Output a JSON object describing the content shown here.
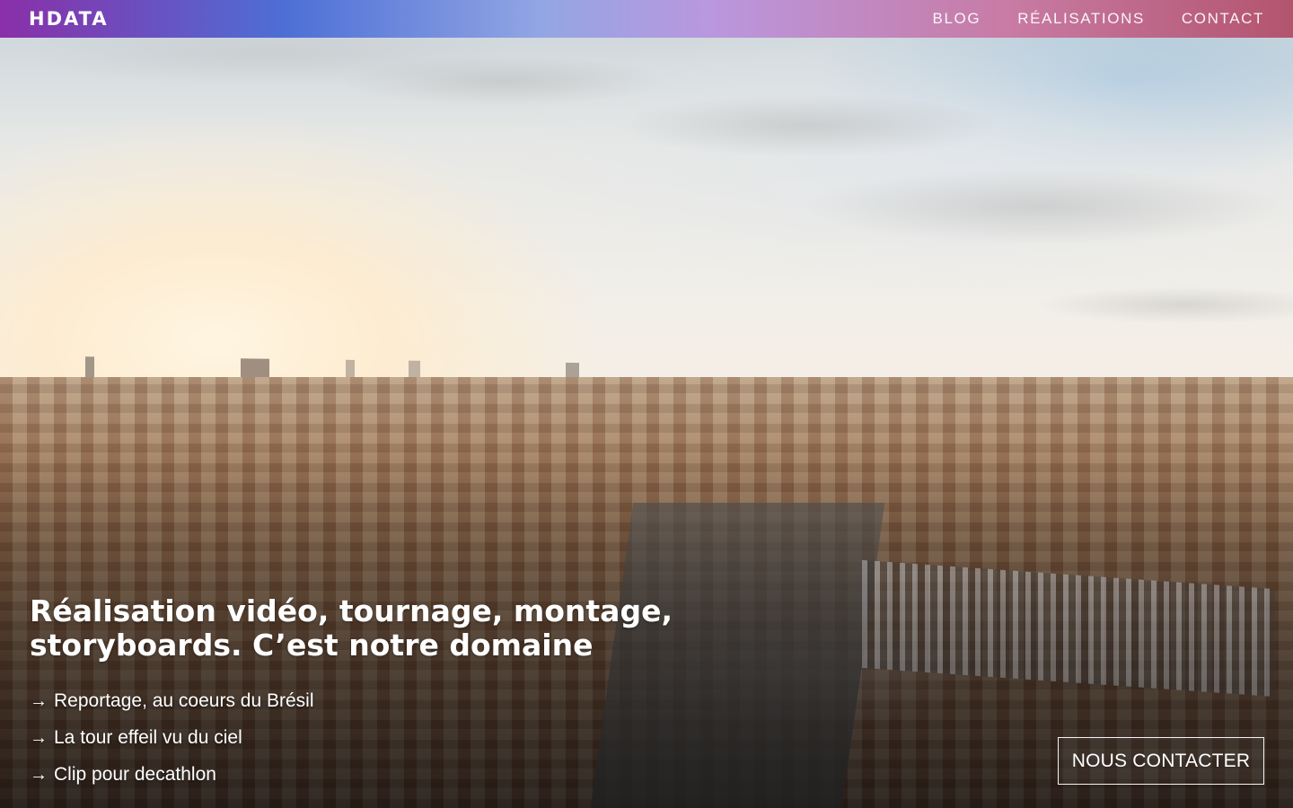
{
  "header": {
    "brand": "HDATA",
    "nav": [
      {
        "label": "BLOG"
      },
      {
        "label": "RÉALISATIONS"
      },
      {
        "label": "CONTACT"
      }
    ]
  },
  "hero": {
    "title_line1": "Réalisation vidéo, tournage, montage,",
    "title_line2": "storyboards. C’est notre domaine",
    "arrow_icon": "→",
    "projects": [
      {
        "label": "Reportage, au coeurs du Brésil"
      },
      {
        "label": "La tour effeil vu du ciel"
      },
      {
        "label": "Clip pour decathlon"
      }
    ],
    "cta_label": "NOUS CONTACTER"
  },
  "theme": {
    "nav_gradient": [
      "#8a2fa8",
      "#4d6fd6",
      "#93a6e4",
      "#ba97de",
      "#c87ba4",
      "#b3546e"
    ],
    "text_color": "#ffffff"
  }
}
